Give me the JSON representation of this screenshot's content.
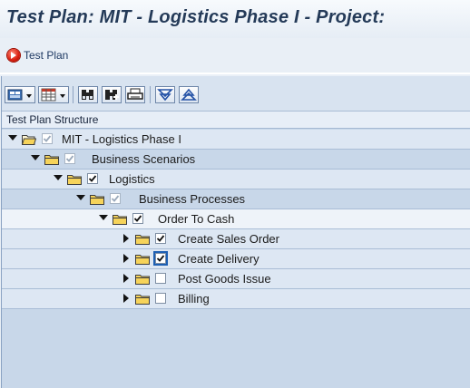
{
  "window": {
    "title": "Test Plan: MIT - Logistics Phase I -  Project:"
  },
  "app_toolbar": {
    "test_plan_button": {
      "label": "Test Plan",
      "icon": "red-circle-arrow-icon"
    }
  },
  "tree_toolbar": {
    "buttons": [
      {
        "name": "layout-button",
        "icon": "layout-icon"
      },
      {
        "name": "table-view-button",
        "icon": "table-icon"
      },
      {
        "name": "find-button",
        "icon": "binoculars-icon"
      },
      {
        "name": "find-next-button",
        "icon": "binoculars-plus-icon"
      },
      {
        "name": "print-button",
        "icon": "printer-icon"
      },
      {
        "name": "expand-all-button",
        "icon": "expand-icon"
      },
      {
        "name": "collapse-all-button",
        "icon": "collapse-icon"
      }
    ]
  },
  "tree": {
    "header": "Test Plan Structure",
    "nodes": [
      {
        "label": "MIT - Logistics Phase I",
        "level": 0,
        "expanded": true,
        "checked": true,
        "checkbox_disabled": true,
        "folder": "open"
      },
      {
        "label": "Business Scenarios",
        "level": 1,
        "expanded": true,
        "checked": true,
        "checkbox_disabled": true,
        "folder": "closed"
      },
      {
        "label": "Logistics",
        "level": 2,
        "expanded": true,
        "checked": true,
        "checkbox_disabled": false,
        "folder": "closed"
      },
      {
        "label": "Business Processes",
        "level": 3,
        "expanded": true,
        "checked": true,
        "checkbox_disabled": true,
        "folder": "closed"
      },
      {
        "label": "Order To Cash",
        "level": 4,
        "expanded": true,
        "checked": true,
        "checkbox_disabled": false,
        "folder": "closed"
      },
      {
        "label": "Create Sales Order",
        "level": 5,
        "expanded": false,
        "checked": true,
        "checkbox_disabled": false,
        "folder": "closed"
      },
      {
        "label": "Create Delivery",
        "level": 5,
        "expanded": false,
        "checked": true,
        "checkbox_disabled": false,
        "folder": "closed",
        "focused": true
      },
      {
        "label": "Post Goods Issue",
        "level": 5,
        "expanded": false,
        "checked": false,
        "checkbox_disabled": false,
        "folder": "closed"
      },
      {
        "label": "Billing",
        "level": 5,
        "expanded": false,
        "checked": false,
        "checkbox_disabled": false,
        "folder": "closed"
      }
    ]
  },
  "colors": {
    "title_text": "#243a58",
    "panel_bg": "#c8d7e9",
    "folder": "#f6d35a"
  }
}
